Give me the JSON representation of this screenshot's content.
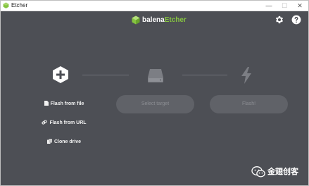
{
  "window": {
    "title": "Etcher",
    "controls": {
      "minimize": "—",
      "maximize": "☐",
      "close": "✕"
    }
  },
  "header": {
    "logo_part1": "balena",
    "logo_part2": "Etcher",
    "settings_icon": "gear-icon",
    "help_icon": "question-icon"
  },
  "steps": {
    "source_icon": "plus-hexagon-icon",
    "target_icon": "drive-icon",
    "flash_icon": "lightning-icon"
  },
  "source_options": [
    {
      "label": "Flash from file",
      "icon": "file-icon"
    },
    {
      "label": "Flash from URL",
      "icon": "link-icon"
    },
    {
      "label": "Clone drive",
      "icon": "copy-icon"
    }
  ],
  "buttons": {
    "select_target": "Select target",
    "flash": "Flash!"
  },
  "watermark": {
    "text": "金翅创客",
    "icon": "wechat-icon"
  },
  "colors": {
    "background": "#4d4f55",
    "accent": "#85c440",
    "pill": "#606268",
    "pill_text": "#8c8e93"
  }
}
